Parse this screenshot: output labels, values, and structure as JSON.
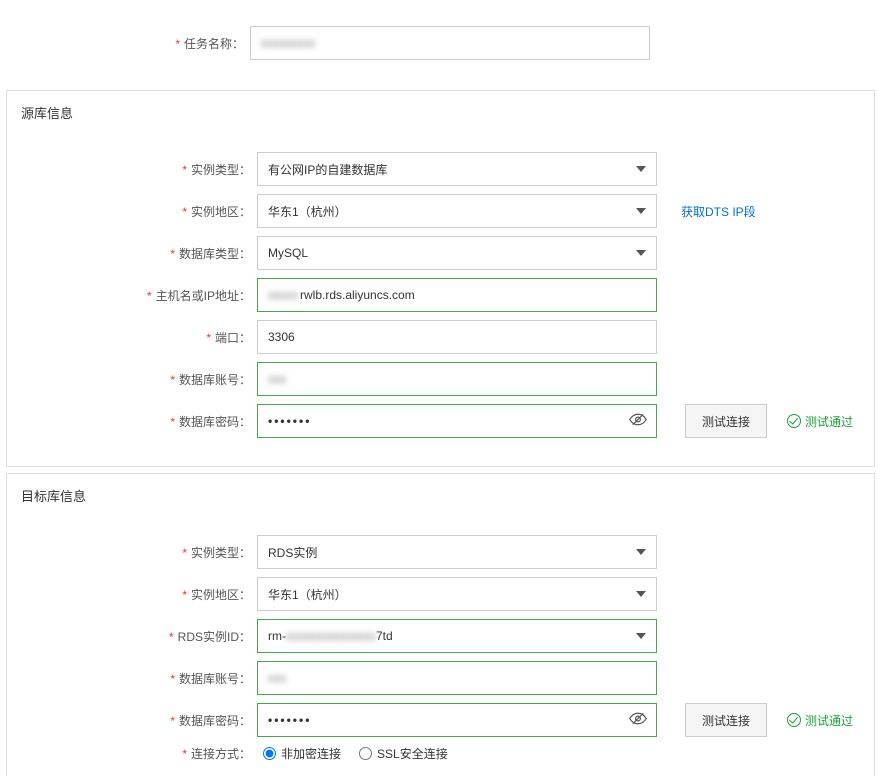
{
  "task": {
    "label": "任务名称：",
    "value_masked": "xxxxxxxxx"
  },
  "source": {
    "title": "源库信息",
    "instance_type_label": "实例类型：",
    "instance_type_value": "有公网IP的自建数据库",
    "region_label": "实例地区：",
    "region_value": "华东1（杭州）",
    "dts_ip_link": "获取DTS IP段",
    "db_type_label": "数据库类型：",
    "db_type_value": "MySQL",
    "host_label": "主机名或IP地址：",
    "host_prefix_masked": "xxxxx",
    "host_suffix": "rwlb.rds.aliyuncs.com",
    "port_label": "端口：",
    "port_value": "3306",
    "account_label": "数据库账号：",
    "account_masked": "xxx",
    "password_label": "数据库密码：",
    "password_dots": "•••••••",
    "test_btn": "测试连接",
    "test_ok": "测试通过"
  },
  "target": {
    "title": "目标库信息",
    "instance_type_label": "实例类型：",
    "instance_type_value": "RDS实例",
    "region_label": "实例地区：",
    "region_value": "华东1（杭州）",
    "rds_id_label": "RDS实例ID：",
    "rds_id_prefix": "rm-",
    "rds_id_masked": "xxxxxxxxxxxxxxx",
    "rds_id_suffix": "7td",
    "account_label": "数据库账号：",
    "account_masked": "xxx",
    "password_label": "数据库密码：",
    "password_dots": "•••••••",
    "test_btn": "测试连接",
    "test_ok": "测试通过",
    "conn_mode_label": "连接方式：",
    "conn_mode_opt1": "非加密连接",
    "conn_mode_opt2": "SSL安全连接"
  }
}
